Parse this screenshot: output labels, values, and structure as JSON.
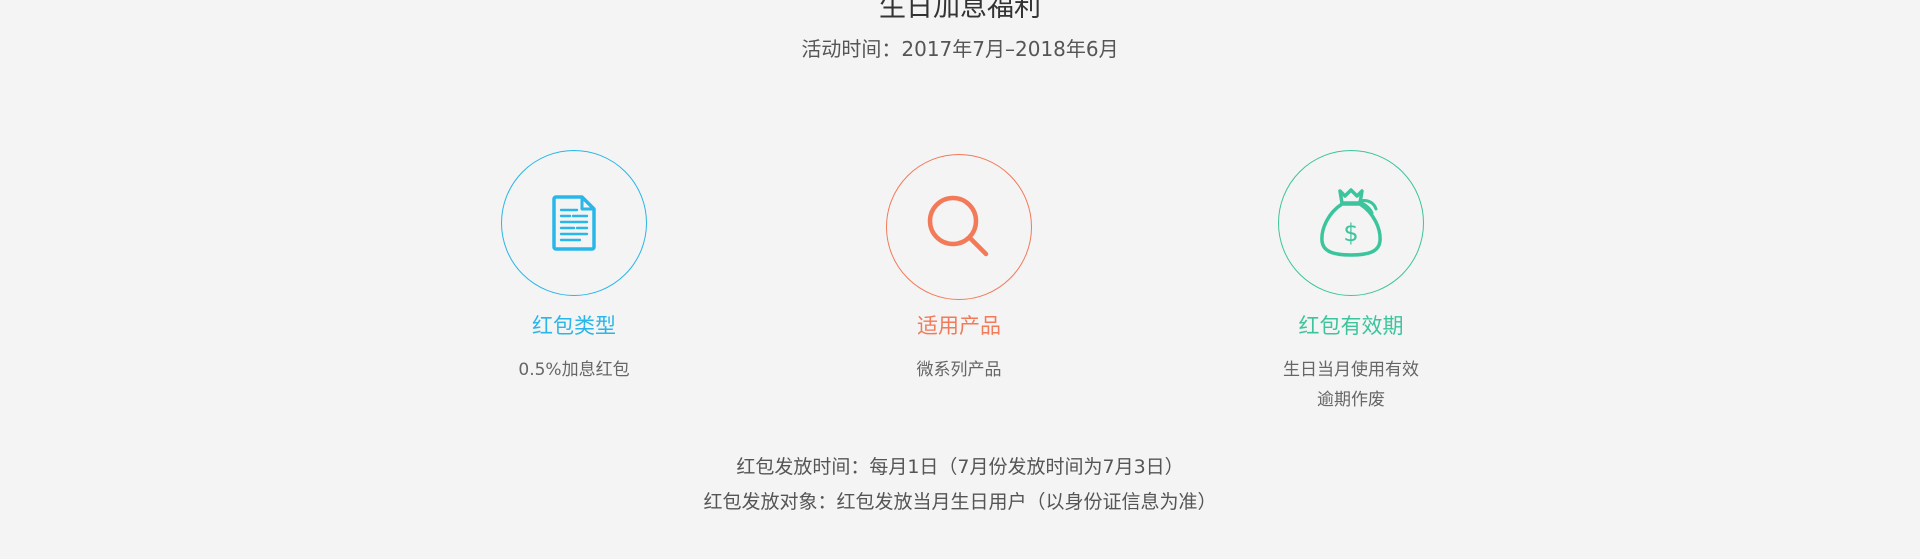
{
  "header": {
    "title": "生日加息福利",
    "activity_period": "活动时间：2017年7月–2018年6月"
  },
  "features": [
    {
      "icon": "document-icon",
      "color": "#29b6e8",
      "title": "红包类型",
      "desc_lines": [
        "0.5%加息红包"
      ]
    },
    {
      "icon": "search-icon",
      "color": "#f27a59",
      "title": "适用产品",
      "desc_lines": [
        "微系列产品"
      ]
    },
    {
      "icon": "money-bag-icon",
      "color": "#3cc49c",
      "title": "红包有效期",
      "desc_lines": [
        "生日当月使用有效",
        "逾期作废"
      ]
    }
  ],
  "info": {
    "issue_time": "红包发放时间：每月1日（7月份发放时间为7月3日）",
    "issue_target": "红包发放对象：红包发放当月生日用户（以身份证信息为准）"
  }
}
